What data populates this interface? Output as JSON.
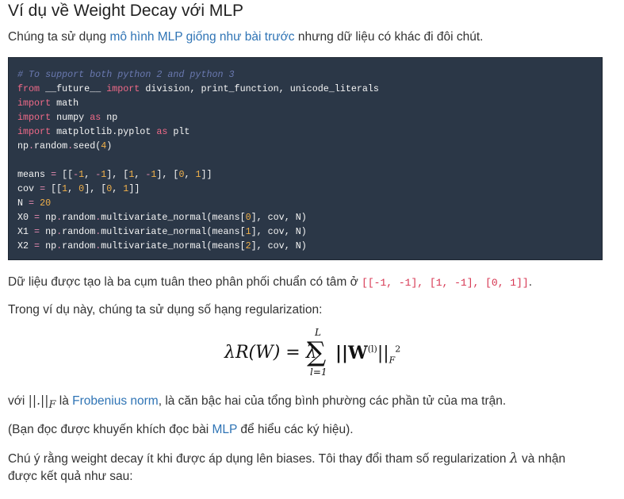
{
  "heading": "Ví dụ về Weight Decay với MLP",
  "intro": {
    "before": "Chúng ta sử dụng ",
    "link": "mô hình MLP giống như bài trước",
    "after": " nhưng dữ liệu có khác đi đôi chút."
  },
  "code_lines": [
    [
      [
        "c",
        "# To support both python 2 and python 3"
      ]
    ],
    [
      [
        "k",
        "from"
      ],
      [
        "t",
        " __future__ "
      ],
      [
        "k",
        "import"
      ],
      [
        "t",
        " division, print_function, unicode_literals"
      ]
    ],
    [
      [
        "k",
        "import"
      ],
      [
        "t",
        " math"
      ]
    ],
    [
      [
        "k",
        "import"
      ],
      [
        "t",
        " numpy "
      ],
      [
        "k",
        "as"
      ],
      [
        "t",
        " np"
      ]
    ],
    [
      [
        "k",
        "import"
      ],
      [
        "t",
        " matplotlib.pyplot "
      ],
      [
        "k",
        "as"
      ],
      [
        "t",
        " plt"
      ]
    ],
    [
      [
        "t",
        "np"
      ],
      [
        "o",
        "."
      ],
      [
        "t",
        "random"
      ],
      [
        "o",
        "."
      ],
      [
        "t",
        "seed("
      ],
      [
        "n",
        "4"
      ],
      [
        "t",
        ")"
      ]
    ],
    [
      [
        "t",
        ""
      ]
    ],
    [
      [
        "t",
        "means "
      ],
      [
        "o",
        "="
      ],
      [
        "t",
        " [["
      ],
      [
        "o",
        "-"
      ],
      [
        "n",
        "1"
      ],
      [
        "t",
        ", "
      ],
      [
        "o",
        "-"
      ],
      [
        "n",
        "1"
      ],
      [
        "t",
        "], ["
      ],
      [
        "n",
        "1"
      ],
      [
        "t",
        ", "
      ],
      [
        "o",
        "-"
      ],
      [
        "n",
        "1"
      ],
      [
        "t",
        "], ["
      ],
      [
        "n",
        "0"
      ],
      [
        "t",
        ", "
      ],
      [
        "n",
        "1"
      ],
      [
        "t",
        "]]"
      ]
    ],
    [
      [
        "t",
        "cov "
      ],
      [
        "o",
        "="
      ],
      [
        "t",
        " [["
      ],
      [
        "n",
        "1"
      ],
      [
        "t",
        ", "
      ],
      [
        "n",
        "0"
      ],
      [
        "t",
        "], ["
      ],
      [
        "n",
        "0"
      ],
      [
        "t",
        ", "
      ],
      [
        "n",
        "1"
      ],
      [
        "t",
        "]]"
      ]
    ],
    [
      [
        "t",
        "N "
      ],
      [
        "o",
        "="
      ],
      [
        "t",
        " "
      ],
      [
        "n",
        "20"
      ]
    ],
    [
      [
        "t",
        "X0 "
      ],
      [
        "o",
        "="
      ],
      [
        "t",
        " np"
      ],
      [
        "o",
        "."
      ],
      [
        "t",
        "random"
      ],
      [
        "o",
        "."
      ],
      [
        "t",
        "multivariate_normal(means["
      ],
      [
        "n",
        "0"
      ],
      [
        "t",
        "], cov, N)"
      ]
    ],
    [
      [
        "t",
        "X1 "
      ],
      [
        "o",
        "="
      ],
      [
        "t",
        " np"
      ],
      [
        "o",
        "."
      ],
      [
        "t",
        "random"
      ],
      [
        "o",
        "."
      ],
      [
        "t",
        "multivariate_normal(means["
      ],
      [
        "n",
        "1"
      ],
      [
        "t",
        "], cov, N)"
      ]
    ],
    [
      [
        "t",
        "X2 "
      ],
      [
        "o",
        "="
      ],
      [
        "t",
        " np"
      ],
      [
        "o",
        "."
      ],
      [
        "t",
        "random"
      ],
      [
        "o",
        "."
      ],
      [
        "t",
        "multivariate_normal(means["
      ],
      [
        "n",
        "2"
      ],
      [
        "t",
        "], cov, N)"
      ]
    ]
  ],
  "data_desc": {
    "text": "Dữ liệu được tạo là ba cụm tuân theo phân phối chuẩn có tâm ở ",
    "code": "[[-1, -1], [1, -1], [0, 1]]",
    "end": "."
  },
  "reg_intro": "Trong ví dụ này, chúng ta sử dụng số hạng regularization:",
  "formula": {
    "left": "λR(W) = λ",
    "sum": "∑",
    "upper": "L",
    "lower": "l=1",
    "right_base": "||W",
    "right_sup": "(l)",
    "right_close": "||",
    "right_sub": "F",
    "right_pow": "2"
  },
  "norm_line": {
    "before": "với ",
    "norm": "||.||",
    "norm_sub": "F",
    "mid": " là ",
    "link": "Frobenius norm",
    "after": ", là căn bậc hai của tổng bình phường các phần tử của ma trận."
  },
  "read_line": {
    "before": "(Bạn đọc được khuyến khích đọc bài ",
    "link": "MLP",
    "after": " để hiểu các ký hiệu)."
  },
  "note_line1": {
    "text": "Chú ý rằng weight decay ít khi được áp dụng lên biases. Tôi thay đổi tham số regularization ",
    "symbol": "λ",
    "after": " và nhận"
  },
  "note_line2": "được kết quả như sau:"
}
